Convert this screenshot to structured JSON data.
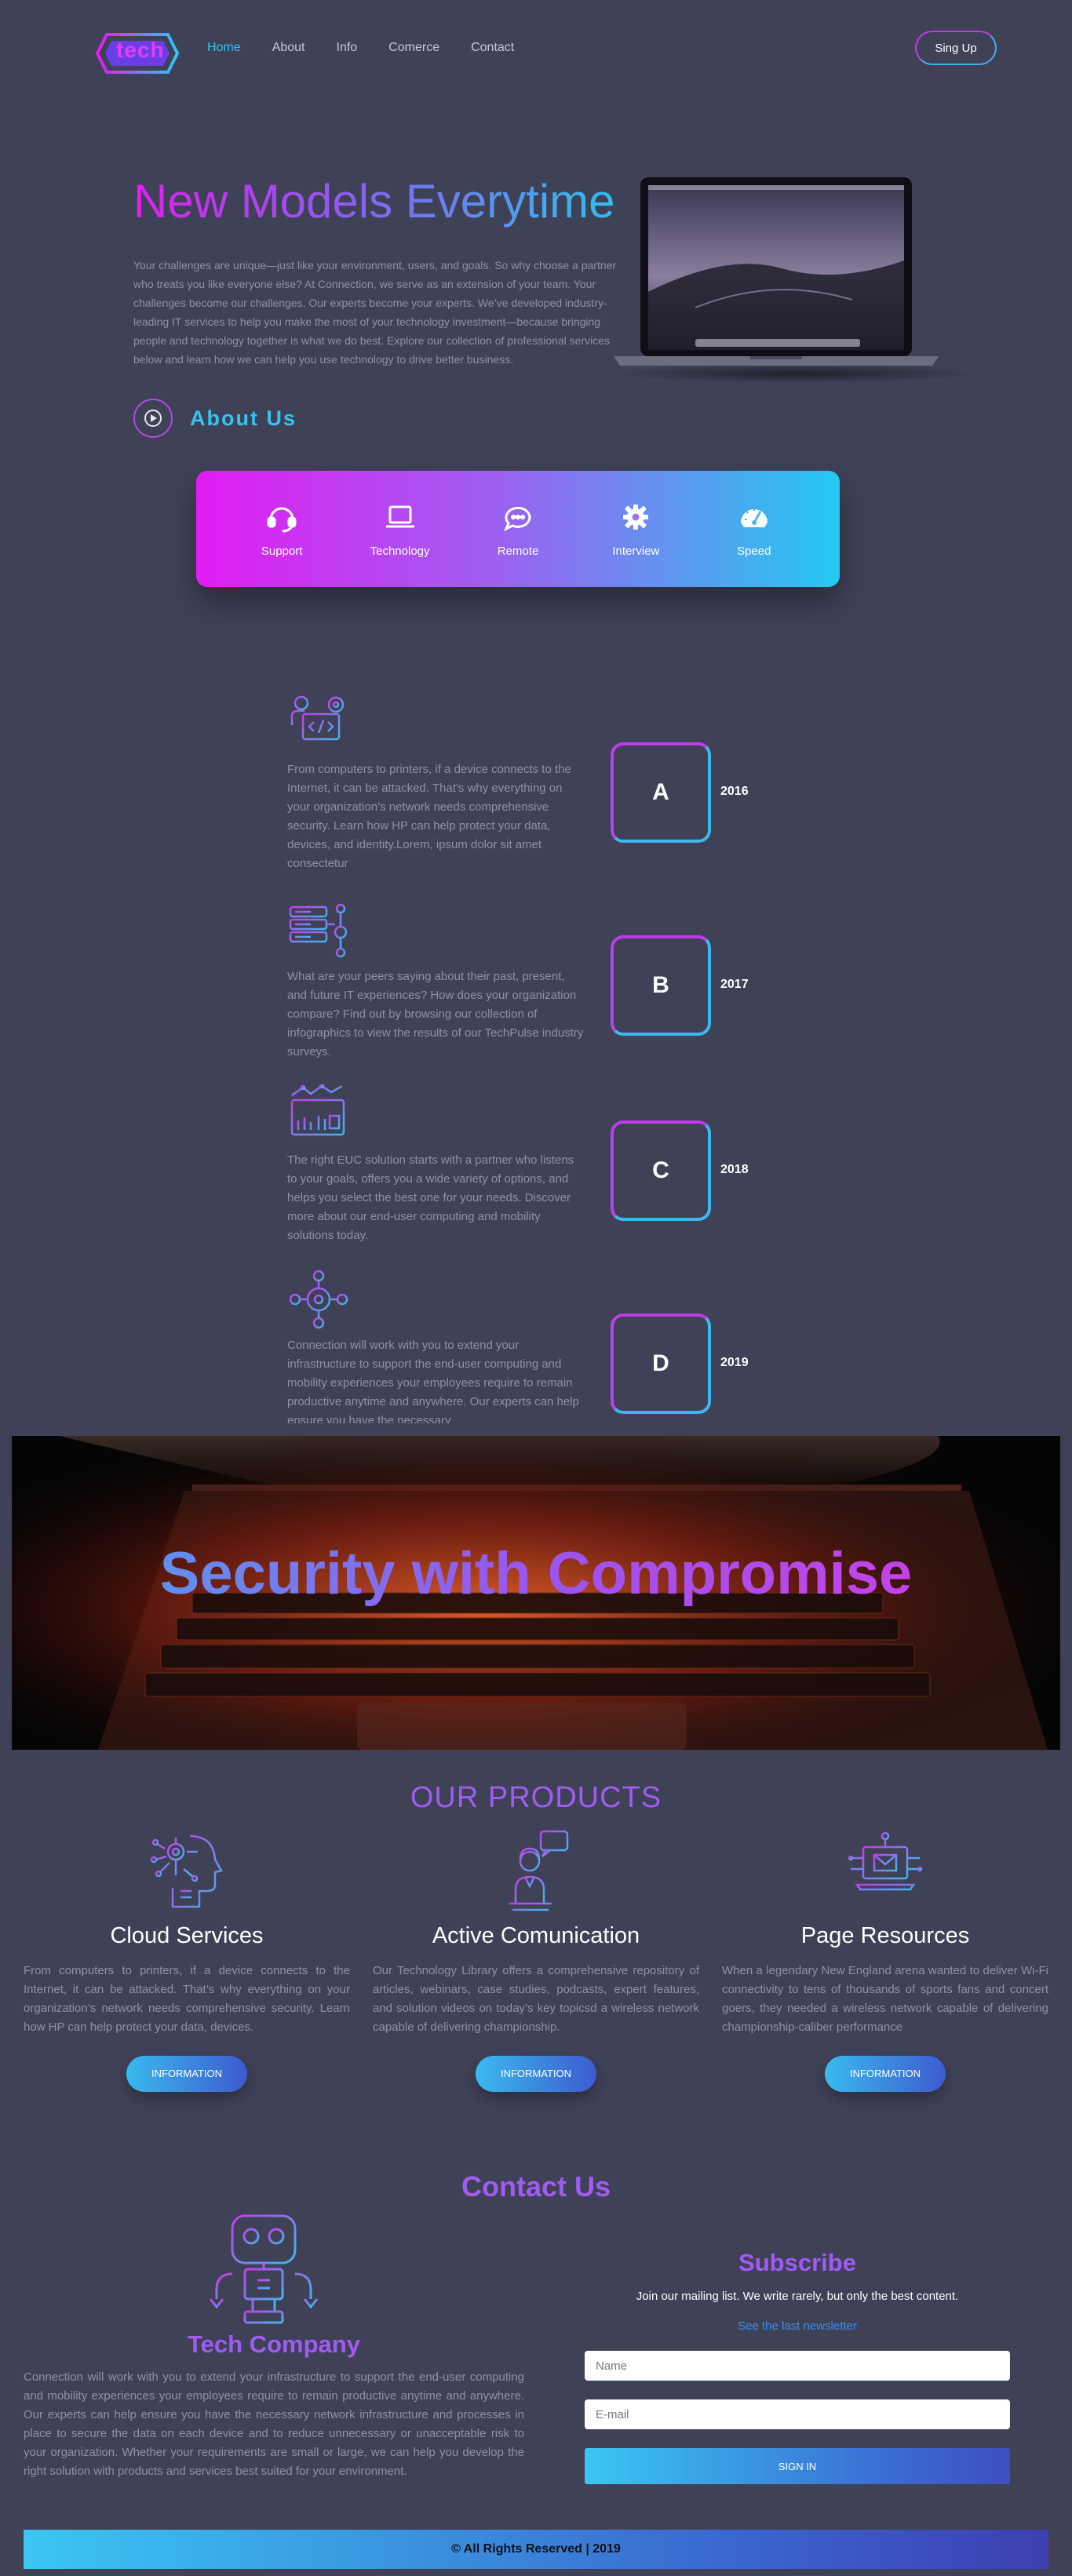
{
  "nav": {
    "logo_text": "tech",
    "links": [
      "Home",
      "About",
      "Info",
      "Comerce",
      "Contact"
    ],
    "active": "Home",
    "signup_label": "Sing Up"
  },
  "hero": {
    "title": "New Models Everytime",
    "text": "Your challenges are unique—just like your environment, users, and goals. So why choose a partner who treats you like everyone else? At Connection, we serve as an extension of your team. Your challenges become our challenges. Our experts become your experts. We’ve developed industry-leading IT services to help you make the most of your technology investment—because bringing people and technology together is what we do best. Explore our collection of professional services below and learn how we can help you use technology to drive better business.",
    "about_label": "About Us"
  },
  "features": [
    {
      "label": "Support",
      "icon": "headset-icon"
    },
    {
      "label": "Technology",
      "icon": "laptop-icon"
    },
    {
      "label": "Remote",
      "icon": "chat-bubble-icon"
    },
    {
      "label": "Interview",
      "icon": "gear-icon"
    },
    {
      "label": "Speed",
      "icon": "speedometer-icon"
    }
  ],
  "timeline": [
    {
      "letter": "A",
      "year": "2016",
      "icon": "developer-icon",
      "text": "From computers to printers, if a device connects to the Internet, it can be attacked. That’s why everything on your organization’s network needs comprehensive security. Learn how HP can help protect your data, devices, and identity.Lorem, ipsum dolor sit amet consectetur"
    },
    {
      "letter": "B",
      "year": "2017",
      "icon": "server-icon",
      "text": "What are your peers saying about their past, present, and future IT experiences? How does your organization compare? Find out by browsing our collection of infographics to view the results of our TechPulse industry surveys."
    },
    {
      "letter": "C",
      "year": "2018",
      "icon": "analytics-icon",
      "text": "The right EUC solution starts with a partner who listens to your goals, offers you a wide variety of options, and helps you select the best one for your needs. Discover more about our end-user computing and mobility solutions today."
    },
    {
      "letter": "D",
      "year": "2019",
      "icon": "network-icon",
      "text": "Connection will work with you to extend your infrastructure to support the end-user computing and mobility experiences your employees require to remain productive anytime and anywhere. Our experts can help ensure you have the necessary"
    }
  ],
  "banner": {
    "title": "Security with Compromise"
  },
  "products": {
    "heading": "OUR PRODUCTS",
    "items": [
      {
        "title": "Cloud Services",
        "icon": "ai-head-icon",
        "text": "From computers to printers, if a device connects to the Internet, it can be attacked. That’s why everything on your organization’s network needs comprehensive security. Learn how HP can help protect your data, devices.",
        "button": "INFORMATION"
      },
      {
        "title": "Active Comunication",
        "icon": "support-agent-icon",
        "text": "Our Technology Library offers a comprehensive repository of articles, webinars, case studies, podcasts, expert features, and solution videos on today’s key topicsd a wireless network capable of delivering championship.",
        "button": "INFORMATION"
      },
      {
        "title": "Page Resources",
        "icon": "laptop-mail-icon",
        "text": "When a legendary New England arena wanted to deliver Wi-Fi connectivity to tens of thousands of sports fans and concert goers, they needed a wireless network capable of delivering championship-caliber performance",
        "button": "INFORMATION"
      }
    ]
  },
  "contact": {
    "heading": "Contact Us",
    "company_title": "Tech Company",
    "company_text": "Connection will work with you to extend your infrastructure to support the end-user computing and mobility experiences your employees require to remain productive anytime and anywhere. Our experts can help ensure you have the necessary network infrastructure and processes in place to secure the data on each device and to reduce unnecessary or unacceptable risk to your organization. Whether your requirements are small or large, we can help you develop the right solution with products and services best suited for your environment.",
    "subscribe_title": "Subscribe",
    "subscribe_text": "Join our mailing list. We write rarely, but only the best content.",
    "newsletter_link": "See the last newsletter",
    "name_placeholder": "Name",
    "email_placeholder": "E-mail",
    "signin_label": "SIGN IN"
  },
  "footer": {
    "text": "© All Rights Reserved | 2019"
  }
}
